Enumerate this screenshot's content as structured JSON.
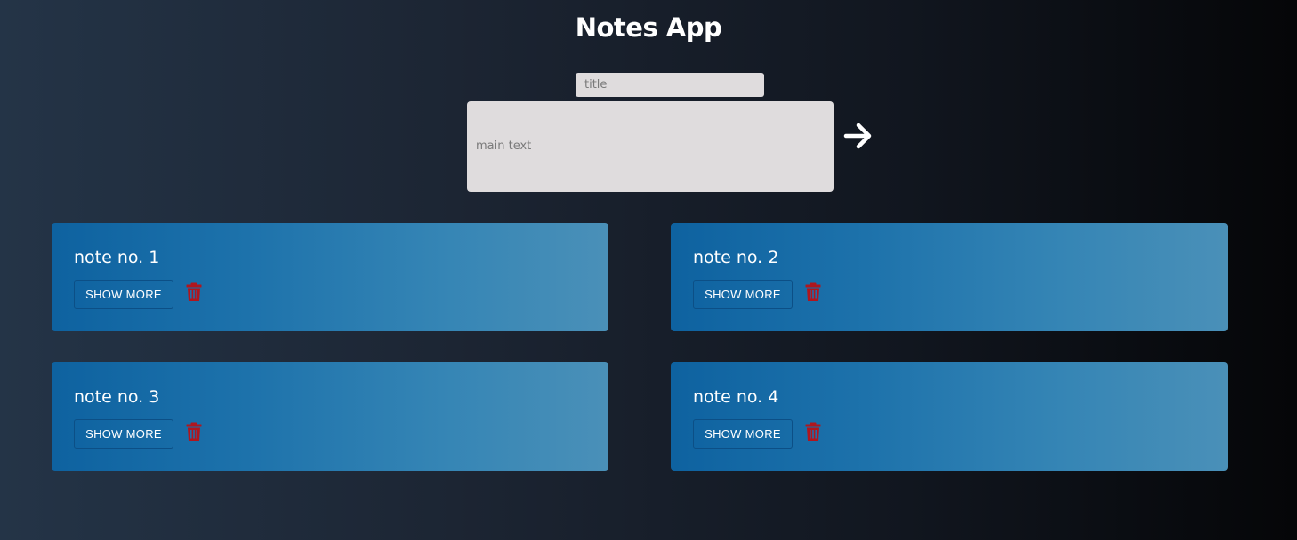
{
  "app": {
    "title": "Notes App"
  },
  "form": {
    "title_placeholder": "title",
    "title_value": "",
    "body_placeholder": "main text",
    "body_value": ""
  },
  "notes": [
    {
      "title": "note no. 1",
      "show_more_label": "SHOW MORE"
    },
    {
      "title": "note no. 2",
      "show_more_label": "SHOW MORE"
    },
    {
      "title": "note no. 3",
      "show_more_label": "SHOW MORE"
    },
    {
      "title": "note no. 4",
      "show_more_label": "SHOW MORE"
    }
  ],
  "icons": {
    "submit": "arrow-right-icon",
    "delete": "trash-icon"
  },
  "colors": {
    "delete_icon": "#b0161e",
    "card_gradient_start": "#0e62a0",
    "card_gradient_end": "#4a90b8",
    "input_bg": "#dfdcdd"
  }
}
